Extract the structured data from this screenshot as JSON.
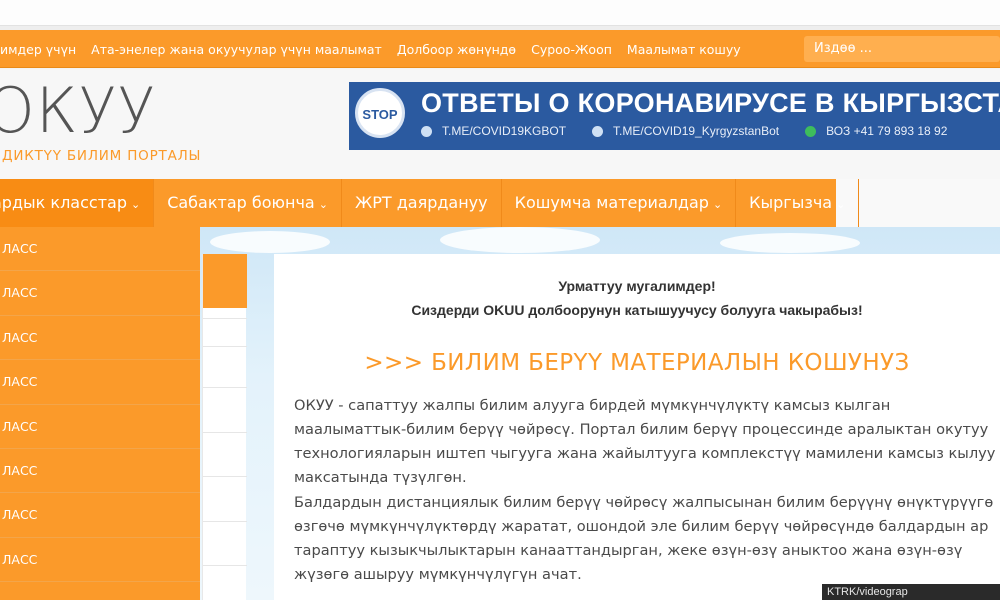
{
  "top_links": [
    "лимдер үчүн",
    "Ата-энелер жана окуучулар үчүн маалымат",
    "Долбоор жөнүндө",
    "Суроо-Жооп",
    "Маалымат кошуу"
  ],
  "search": {
    "placeholder": "Издөө ..."
  },
  "logo": {
    "text": "ОКУУ",
    "tagline": "ДИКТҮҮ БИЛИМ ПОРТАЛЫ"
  },
  "banner": {
    "badge": "STOP",
    "title": "ОТВЕТЫ О КОРОНАВИРУСЕ В КЫРГЫЗСТАН",
    "contacts": [
      "T.ME/COVID19KGBOT",
      "T.ME/COVID19_KyrgyzstanBot",
      "ВОЗ +41 79 893 18 92"
    ]
  },
  "main_nav": [
    {
      "label": "ардык класстар",
      "chevron": "⌄"
    },
    {
      "label": "Сабактар боюнча",
      "chevron": "⌄"
    },
    {
      "label": "ЖРТ даярдануу",
      "chevron": ""
    },
    {
      "label": "Кошумча материалдар",
      "chevron": "⌄"
    },
    {
      "label": "Кыргызча",
      "chevron": "⌄"
    }
  ],
  "sidebar_rows": [
    "ЛАСС",
    "ЛАСС",
    "ЛАСС",
    "ЛАСС",
    "ЛАСС",
    "ЛАСС",
    "ЛАСС",
    "ЛАСС"
  ],
  "content": {
    "greeting_line1": "Урматтуу мугалимдер!",
    "greeting_line2": "Сиздерди OKUU долбоорунун катышуучусу болууга чакырабыз!",
    "cta": ">>> БИЛИМ БЕРҮҮ МАТЕРИАЛЫН КОШУНУЗ",
    "paragraph1": "ОКУУ - сапаттуу жалпы билим алууга бирдей мүмкүнчүлүктү камсыз кылган маалыматтык-билим берүү чөйрөсү. Портал билим берүү процессинде аралыктан окутуу технологияларын иштеп чыгууга жана жайылтууга комплекстүү мамилени камсыз кылуу максатында түзүлгөн.",
    "paragraph2": "Балдардын дистанциялык билим берүү чөйрөсү жалпысынан билим берүүнү өнүктүрүүгө өзгөчө мүмкүнчүлүктөрдү жаратат, ошондой эле билим берүү чөйрөсүндө балдардын ар тараптуу кызыкчылыктарын канааттандырган, жеке өзүн-өзү аныктоо жана өзүн-өзү жүзөгө ашыруу мүмкүнчүлүгүн ачат."
  },
  "credit": "KTRK/videograp"
}
